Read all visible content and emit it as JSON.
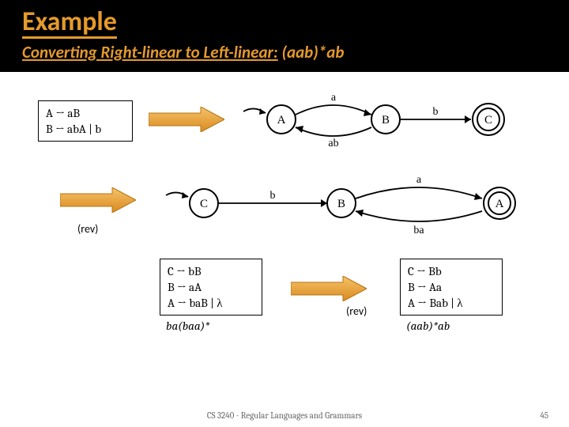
{
  "header": {
    "title": "Example",
    "subtitle_prefix": "Converting Right-linear to Left-linear:",
    "subtitle_expr": "(aab)*ab"
  },
  "grammar1": {
    "line1": "A → aB",
    "line2": "B → abA | b"
  },
  "grammar2": {
    "line1": "C → bB",
    "line2": "B → aA",
    "line3": "A → baB | λ"
  },
  "grammar3": {
    "line1": "C → Bb",
    "line2": "B → Aa",
    "line3": "A → Bab | λ"
  },
  "fsa1": {
    "stateA": "A",
    "stateB": "B",
    "stateC": "C",
    "edge_a": "a",
    "edge_b": "b",
    "edge_ab": "ab"
  },
  "fsa2": {
    "stateA": "A",
    "stateB": "B",
    "stateC": "C",
    "edge_a": "a",
    "edge_b": "b",
    "edge_ba": "ba"
  },
  "labels": {
    "rev1": "(rev)",
    "rev2": "(rev)",
    "caption1": "ba(baa)*",
    "caption2": "(aab)*ab"
  },
  "footer": {
    "center": "CS 3240 - Regular Languages and Grammars",
    "page": "45"
  }
}
